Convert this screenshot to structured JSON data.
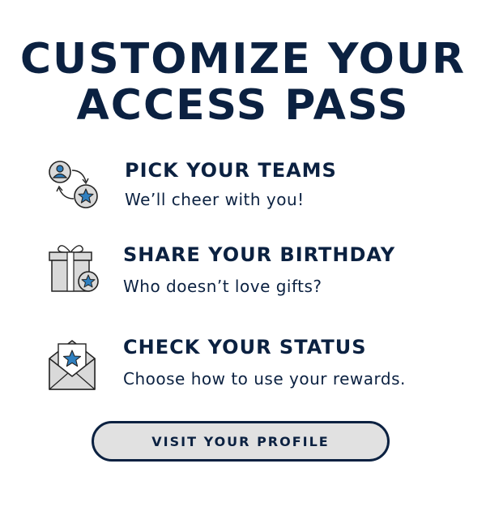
{
  "headline": {
    "line1": "CUSTOMIZE YOUR",
    "line2": "ACCESS PASS"
  },
  "steps": [
    {
      "title": "PICK YOUR TEAMS",
      "subtitle": "We’ll cheer with you!",
      "icon": "teams-swap-icon"
    },
    {
      "title": "SHARE YOUR BIRTHDAY",
      "subtitle": "Who doesn’t love gifts?",
      "icon": "gift-icon"
    },
    {
      "title": "CHECK YOUR STATUS",
      "subtitle": "Choose how to use your rewards.",
      "icon": "envelope-star-icon"
    }
  ],
  "cta": {
    "label": "VISIT YOUR PROFILE"
  },
  "colors": {
    "navy": "#0b2141",
    "accent_blue": "#2f7fbf",
    "icon_gray": "#d9d9d9",
    "button_fill": "#e1e1e1"
  }
}
